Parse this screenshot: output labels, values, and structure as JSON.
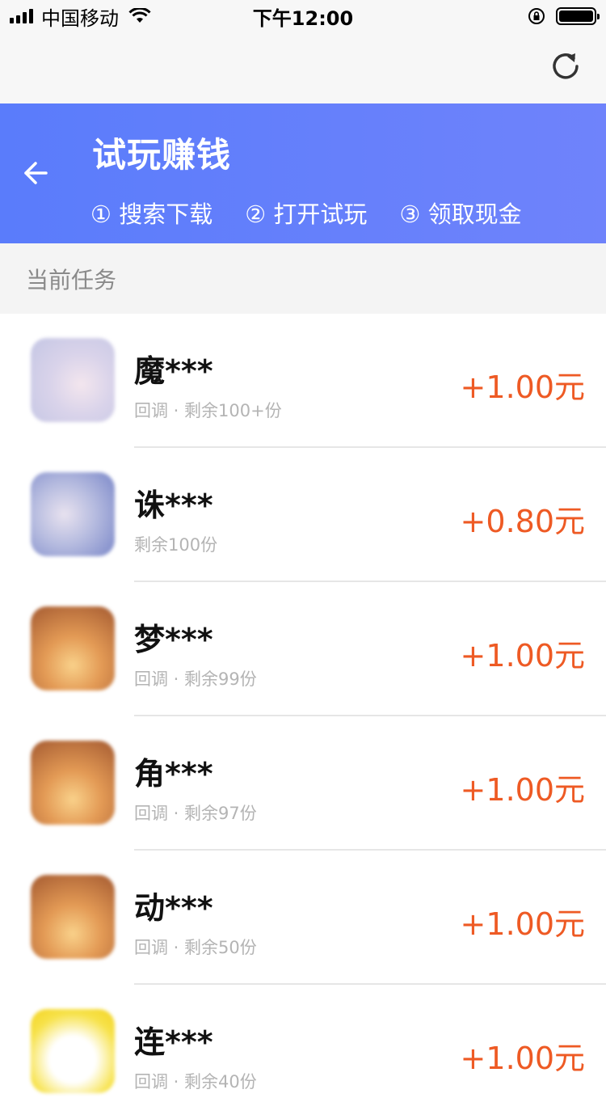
{
  "status_bar": {
    "carrier": "中国移动",
    "time": "下午12:00"
  },
  "header": {
    "title": "试玩赚钱",
    "steps": [
      "① 搜索下载",
      "② 打开试玩",
      "③ 领取现金"
    ]
  },
  "section": {
    "label": "当前任务"
  },
  "tasks": [
    {
      "name": "魔***",
      "meta": "回调 · 剩余100+份",
      "reward": "+1.00元"
    },
    {
      "name": "诛***",
      "meta": "剩余100份",
      "reward": "+0.80元"
    },
    {
      "name": "梦***",
      "meta": "回调 · 剩余99份",
      "reward": "+1.00元"
    },
    {
      "name": "角***",
      "meta": "回调 · 剩余97份",
      "reward": "+1.00元"
    },
    {
      "name": "动***",
      "meta": "回调 · 剩余50份",
      "reward": "+1.00元"
    },
    {
      "name": "连***",
      "meta": "回调 · 剩余40份",
      "reward": "+1.00元"
    }
  ],
  "colors": {
    "header_start": "#5a7cfb",
    "header_end": "#6f83fb",
    "reward": "#ee5a24"
  },
  "icons": {
    "back": "arrow-left-icon",
    "refresh": "refresh-icon",
    "wifi": "wifi-icon",
    "lock": "rotation-lock-icon",
    "battery": "battery-icon"
  }
}
